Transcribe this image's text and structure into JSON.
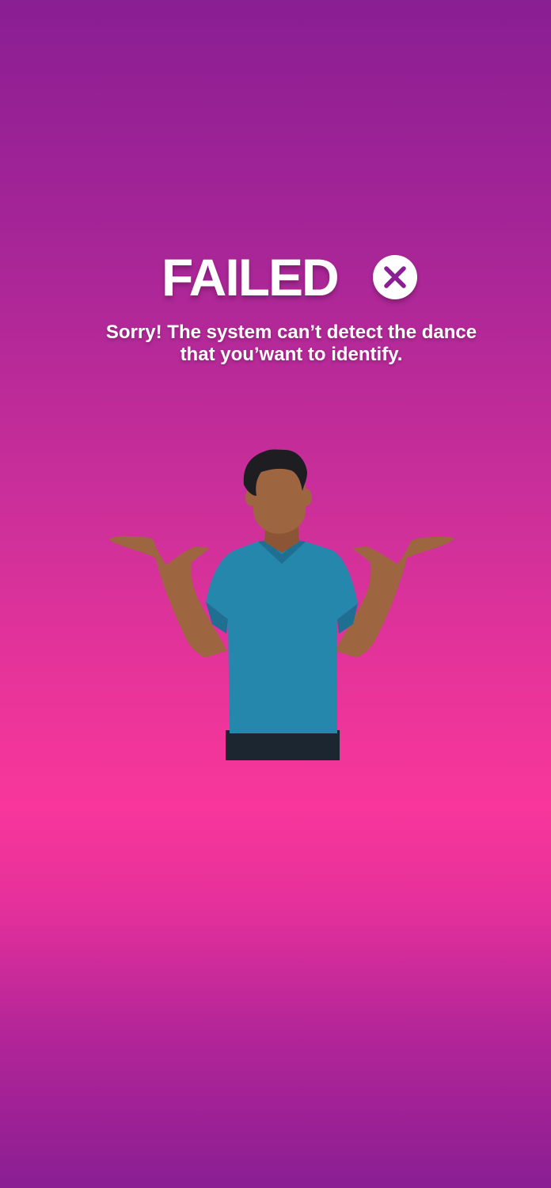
{
  "status": {
    "title": "FAILED",
    "icon": "close-circle-icon",
    "message_line1": "Sorry! The system can’t detect the dance",
    "message_line2": "that you’want to identify."
  },
  "illustration": {
    "name": "shrugging-person"
  },
  "colors": {
    "background_top": "#8a1e93",
    "background_mid": "#f8369b",
    "text": "#ffffff",
    "icon_fill": "#ffffff",
    "icon_mark": "#8a1e93"
  }
}
